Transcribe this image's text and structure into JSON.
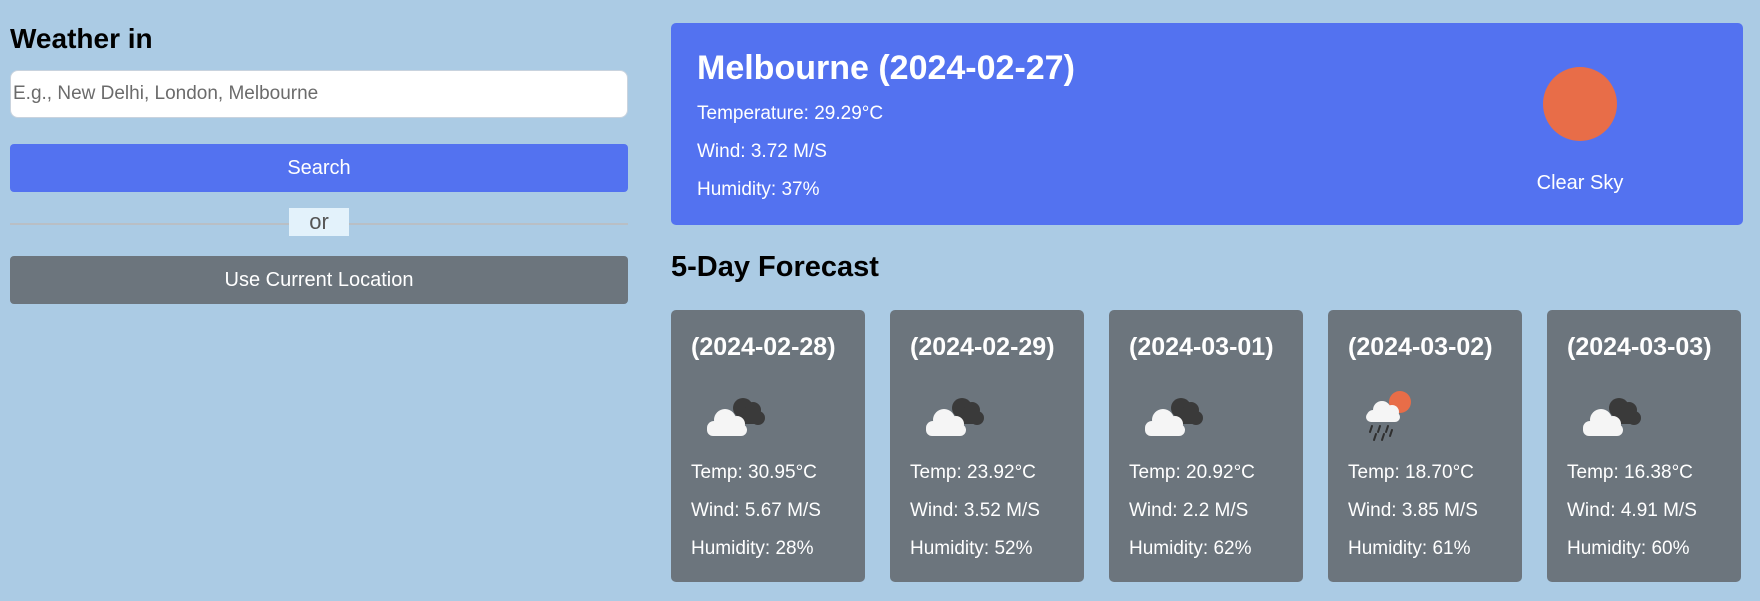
{
  "search": {
    "heading": "Weather in",
    "placeholder": "E.g., New Delhi, London, Melbourne",
    "search_button": "Search",
    "separator": "or",
    "location_button": "Use Current Location"
  },
  "current": {
    "title": "Melbourne (2024-02-27)",
    "temperature": "Temperature: 29.29°C",
    "wind": "Wind: 3.72 M/S",
    "humidity": "Humidity: 37%",
    "icon": "sun-icon",
    "description": "Clear Sky"
  },
  "forecast": {
    "heading": "5-Day Forecast",
    "days": [
      {
        "date": "(2024-02-28)",
        "icon": "broken-clouds-icon",
        "temp": "Temp: 30.95°C",
        "wind": "Wind: 5.67 M/S",
        "humidity": "Humidity: 28%"
      },
      {
        "date": "(2024-02-29)",
        "icon": "broken-clouds-icon",
        "temp": "Temp: 23.92°C",
        "wind": "Wind: 3.52 M/S",
        "humidity": "Humidity: 52%"
      },
      {
        "date": "(2024-03-01)",
        "icon": "broken-clouds-icon",
        "temp": "Temp: 20.92°C",
        "wind": "Wind: 2.2 M/S",
        "humidity": "Humidity: 62%"
      },
      {
        "date": "(2024-03-02)",
        "icon": "rain-sun-icon",
        "temp": "Temp: 18.70°C",
        "wind": "Wind: 3.85 M/S",
        "humidity": "Humidity: 61%"
      },
      {
        "date": "(2024-03-03)",
        "icon": "broken-clouds-icon",
        "temp": "Temp: 16.38°C",
        "wind": "Wind: 4.91 M/S",
        "humidity": "Humidity: 60%"
      }
    ]
  },
  "colors": {
    "background": "#abcbe4",
    "accent": "#5372f0",
    "card": "#6c757d",
    "sun": "#e86d48"
  }
}
